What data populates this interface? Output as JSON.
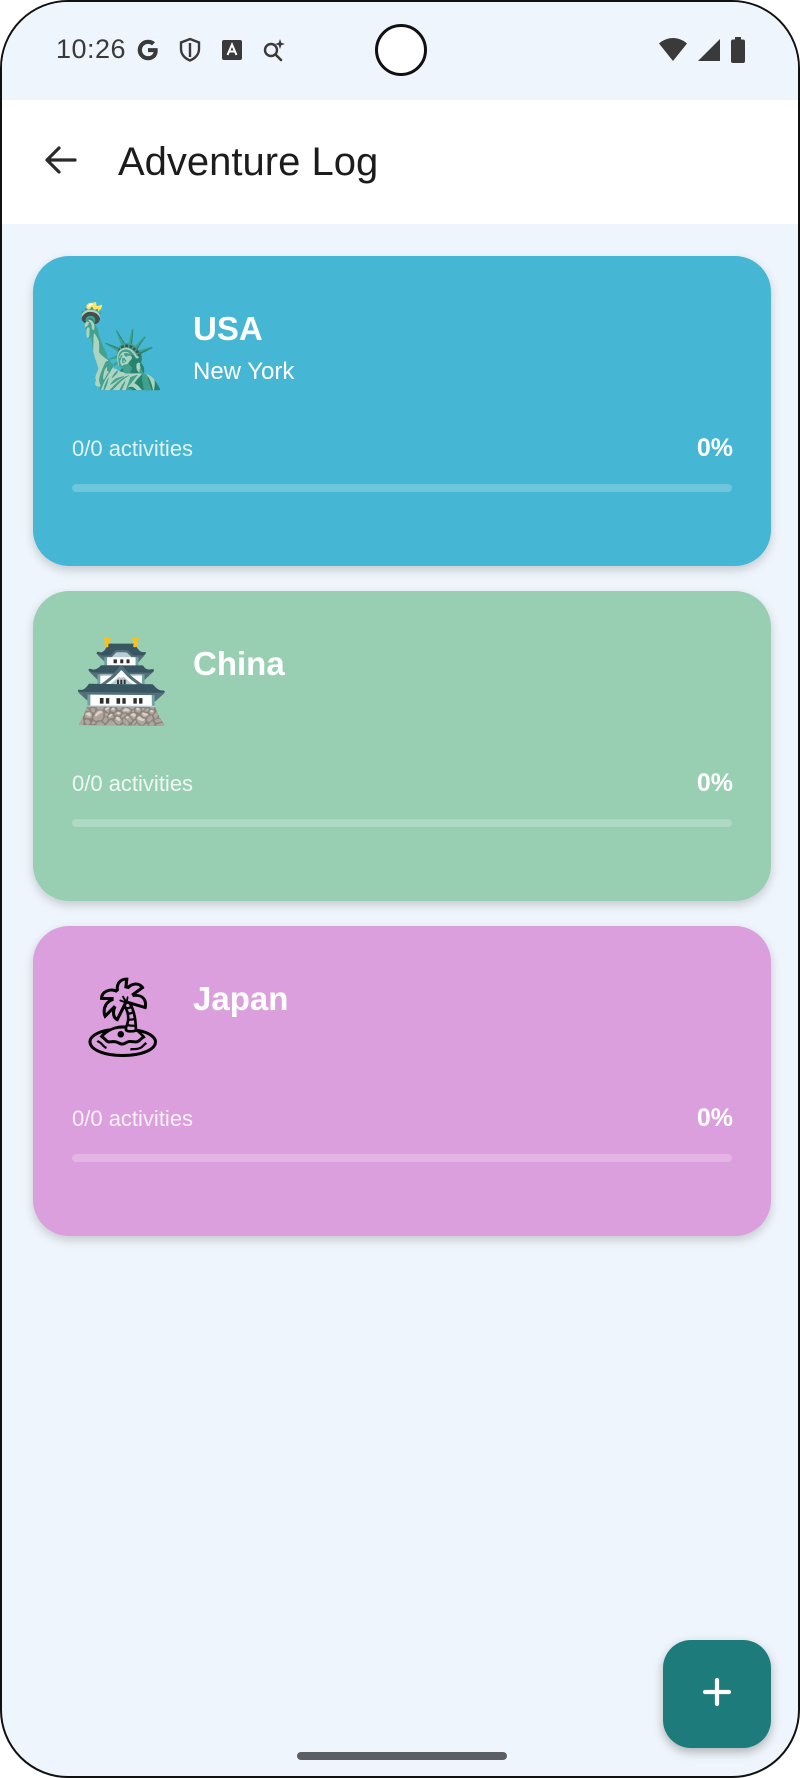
{
  "status_bar": {
    "time": "10:26",
    "left_icons": [
      "google-icon",
      "shield-icon",
      "text-badge-icon",
      "search-sparkle-icon"
    ],
    "right_icons": [
      "wifi-icon",
      "cell-signal-icon",
      "battery-icon"
    ]
  },
  "app_bar": {
    "title": "Adventure Log",
    "back_icon": "arrow-left-icon"
  },
  "cards": [
    {
      "country": "USA",
      "city": "New York",
      "emoji": "🗽",
      "activities": "0/0 activities",
      "percent": "0%",
      "progress": 0,
      "color": "#45b6d3"
    },
    {
      "country": "China",
      "city": "",
      "emoji": "🏯",
      "activities": "0/0 activities",
      "percent": "0%",
      "progress": 0,
      "color": "#98cfb3"
    },
    {
      "country": "Japan",
      "city": "",
      "emoji": "🏝",
      "activities": "0/0 activities",
      "percent": "0%",
      "progress": 0,
      "color": "#db9fdd"
    }
  ],
  "fab": {
    "icon": "plus-icon",
    "color": "#1e7b7c"
  }
}
